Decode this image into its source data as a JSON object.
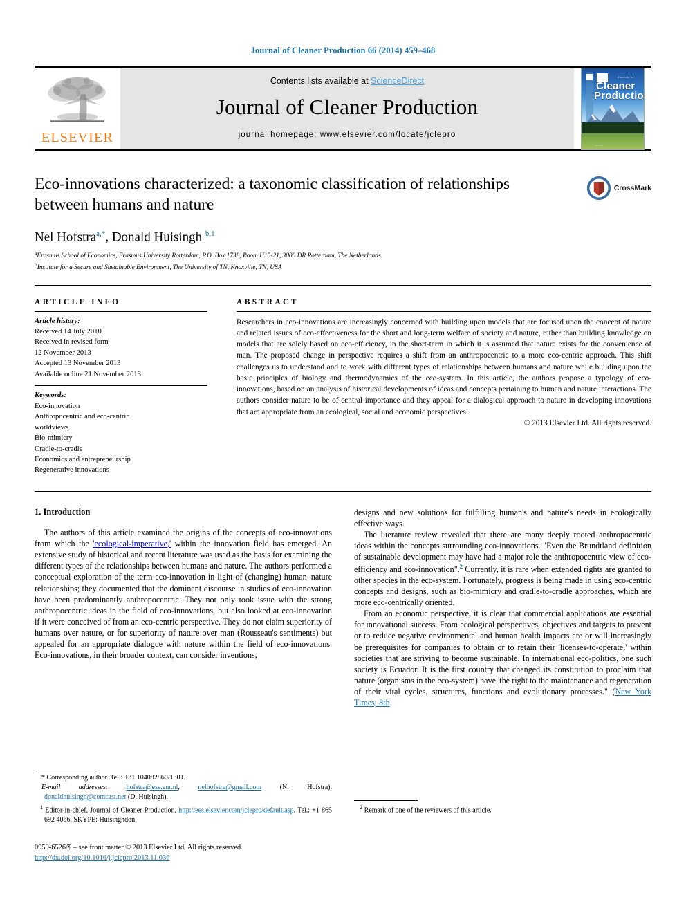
{
  "running_head": "Journal of Cleaner Production 66 (2014) 459–468",
  "masthead": {
    "publisher_name": "ELSEVIER",
    "contents_prefix": "Contents lists available at ",
    "contents_link": "ScienceDirect",
    "journal_name": "Journal of Cleaner Production",
    "homepage": "journal homepage: www.elsevier.com/locate/jclepro",
    "cover": {
      "small_line": "Journal of",
      "line1": "Cleaner",
      "line2": "Production"
    }
  },
  "article": {
    "title": "Eco-innovations characterized: a taxonomic classification of relationships between humans and nature",
    "authors_html": "Nel Hofstra<sup>a,*</sup>, Donald Huisingh <sup>b,1</sup>",
    "affiliations": [
      {
        "marker": "a",
        "text": "Erasmus School of Economics, Erasmus University Rotterdam, P.O. Box 1738, Room H15-21, 3000 DR Rotterdam, The Netherlands"
      },
      {
        "marker": "b",
        "text": "Institute for a Secure and Sustainable Environment, The University of TN, Knoxville, TN, USA"
      }
    ],
    "crossmark_label": "CrossMark"
  },
  "article_info": {
    "heading": "ARTICLE INFO",
    "history_label": "Article history:",
    "history": [
      "Received 14 July 2010",
      "Received in revised form",
      "12 November 2013",
      "Accepted 13 November 2013",
      "Available online 21 November 2013"
    ],
    "keywords_label": "Keywords:",
    "keywords": [
      "Eco-innovation",
      "Anthropocentric and eco-centric",
      "worldviews",
      "Bio-mimicry",
      "Cradle-to-cradle",
      "Economics and entrepreneurship",
      "Regenerative innovations"
    ]
  },
  "abstract": {
    "heading": "ABSTRACT",
    "body": "Researchers in eco-innovations are increasingly concerned with building upon models that are focused upon the concept of nature and related issues of eco-effectiveness for the short and long-term welfare of society and nature, rather than building knowledge on models that are solely based on eco-efficiency, in the short-term in which it is assumed that nature exists for the convenience of man. The proposed change in perspective requires a shift from an anthropocentric to a more eco-centric approach. This shift challenges us to understand and to work with different types of relationships between humans and nature while building upon the basic principles of biology and thermodynamics of the eco-system. In this article, the authors propose a typology of eco-innovations, based on an analysis of historical developments of ideas and concepts pertaining to human and nature interactions. The authors consider nature to be of central importance and they appeal for a dialogical approach to nature in developing innovations that are appropriate from an ecological, social and economic perspectives.",
    "copyright": "© 2013 Elsevier Ltd. All rights reserved."
  },
  "section": {
    "number_title": "1.  Introduction",
    "left_para_1_a": "The authors of this article examined the origins of the concepts of eco-innovations from which the ",
    "left_para_1_link": "'ecological-imperative,'",
    "left_para_1_b": " within the innovation field has emerged. An extensive study of historical and recent literature was used as the basis for examining the different types of the relationships between humans and nature. The authors performed a conceptual exploration of the term eco-innovation in light of (changing) human–nature relationships; they documented that the dominant discourse in studies of eco-innovation have been predominantly anthropocentric. They not only took issue with the strong anthropocentric ideas in the field of eco-innovations, but also looked at eco-innovation if it were conceived of from an eco-centric perspective. They do not claim superiority of humans over nature, or for superiority of nature over man (Rousseau's sentiments) but appealed for an appropriate dialogue with nature within the field of eco-innovations. Eco-innovations, in their broader context, can consider inventions,",
    "right_para_cont": "designs and new solutions for fulfilling human's and nature's needs in ecologically effective ways.",
    "right_para_2_a": "The literature review revealed that there are many deeply rooted anthropocentric ideas within the concepts surrounding eco-innovations. \"Even the Brundtland definition of sustainable development may have had a major role the anthropocentric view of eco-efficiency and eco-innovation\".",
    "right_para_2_fn": "2",
    "right_para_2_b": " Currently, it is rare when extended rights are granted to other species in the eco-system. Fortunately, progress is being made in using eco-centric concepts and designs, such as bio-mimicry and cradle-to-cradle approaches, which are more eco-centrically oriented.",
    "right_para_3_a": "From an economic perspective, it is clear that commercial applications are essential for innovational success. From ecological perspectives, objectives and targets to prevent or to reduce negative environmental and human health impacts are or will increasingly be prerequisites for companies to obtain or to retain their 'licenses-to-operate,' within societies that are striving to become sustainable. In international eco-politics, one such society is Ecuador. It is the first country that changed its constitution to proclaim that nature (organisms in the eco-system) have 'the right to the maintenance and regeneration of their vital cycles, structures, functions and evolutionary processes.\" (",
    "right_para_3_link": "New York Times; 8th"
  },
  "footnotes": {
    "corresponding": "*  Corresponding author. Tel.: +31 104082860/1301.",
    "email_label": "E-mail addresses:",
    "email_1": "hofstra@ese.eur.nl",
    "email_2": "nelhofstra@gmail.com",
    "email_1_owner": "(N. Hofstra),",
    "email_3": "donaldhuisingh@comcast.net",
    "email_3_owner": "(D. Huisingh).",
    "fn1_marker": "1",
    "fn1_a": "Editor-in-chief, Journal of Cleaner Production, ",
    "fn1_link": "http://ees.elsevier.com/jclepro/default.asp",
    "fn1_b": ". Tel.: +1 865 692 4066, SKYPE: Huisinghdon.",
    "fn2_marker": "2",
    "fn2_text": "Remark of one of the reviewers of this article."
  },
  "imprint": {
    "issn_line": "0959-6526/$ – see front matter © 2013 Elsevier Ltd. All rights reserved.",
    "doi": "http://dx.doi.org/10.1016/j.jclepro.2013.11.036"
  },
  "colors": {
    "link_blue": "#1a6fa8",
    "sciencedirect_blue": "#4ba3dd",
    "elsevier_orange": "#ef7b10"
  }
}
